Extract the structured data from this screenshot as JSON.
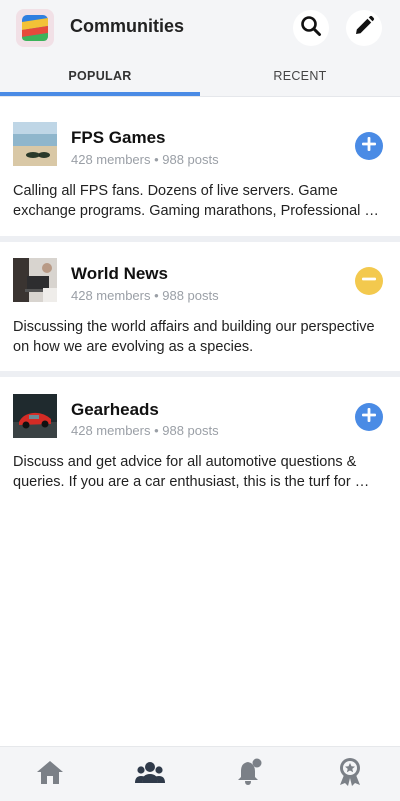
{
  "header": {
    "title": "Communities",
    "logo_icon": "app-logo-icon",
    "search_icon": "search-icon",
    "edit_icon": "pencil-icon"
  },
  "tabs": [
    {
      "label": "POPULAR",
      "active": true
    },
    {
      "label": "RECENT",
      "active": false
    }
  ],
  "communities": [
    {
      "name": "FPS Games",
      "members": "428 members",
      "posts": "988 posts",
      "meta": "428 members • 988 posts",
      "description": "Calling all FPS fans. Dozens of live servers. Game exchange programs. Gaming marathons, Professional …",
      "action": "join",
      "action_icon": "plus-icon",
      "thumbnail_icon": "beach-sunglasses-thumbnail"
    },
    {
      "name": "World News",
      "members": "428 members",
      "posts": "988 posts",
      "meta": "428 members • 988 posts",
      "description": "Discussing the world affairs and building our perspective on how we are evolving as a species.",
      "action": "leave",
      "action_icon": "minus-icon",
      "thumbnail_icon": "laptop-desk-thumbnail"
    },
    {
      "name": "Gearheads",
      "members": "428 members",
      "posts": "988 posts",
      "meta": "428 members • 988 posts",
      "description": "Discuss and get advice for all automotive questions & queries. If you are a car enthusiast, this is the turf for …",
      "action": "join",
      "action_icon": "plus-icon",
      "thumbnail_icon": "red-car-thumbnail"
    }
  ],
  "colors": {
    "accent": "#4a8be5",
    "leave": "#f3c94e",
    "meta_text": "#9a9fa6",
    "nav_active": "#2f3a4a",
    "nav_inactive": "#7b8087"
  },
  "bottom_nav": [
    {
      "icon": "home-icon",
      "active": false
    },
    {
      "icon": "communities-icon",
      "active": true
    },
    {
      "icon": "notification-bell-icon",
      "active": false
    },
    {
      "icon": "award-badge-icon",
      "active": false
    }
  ]
}
